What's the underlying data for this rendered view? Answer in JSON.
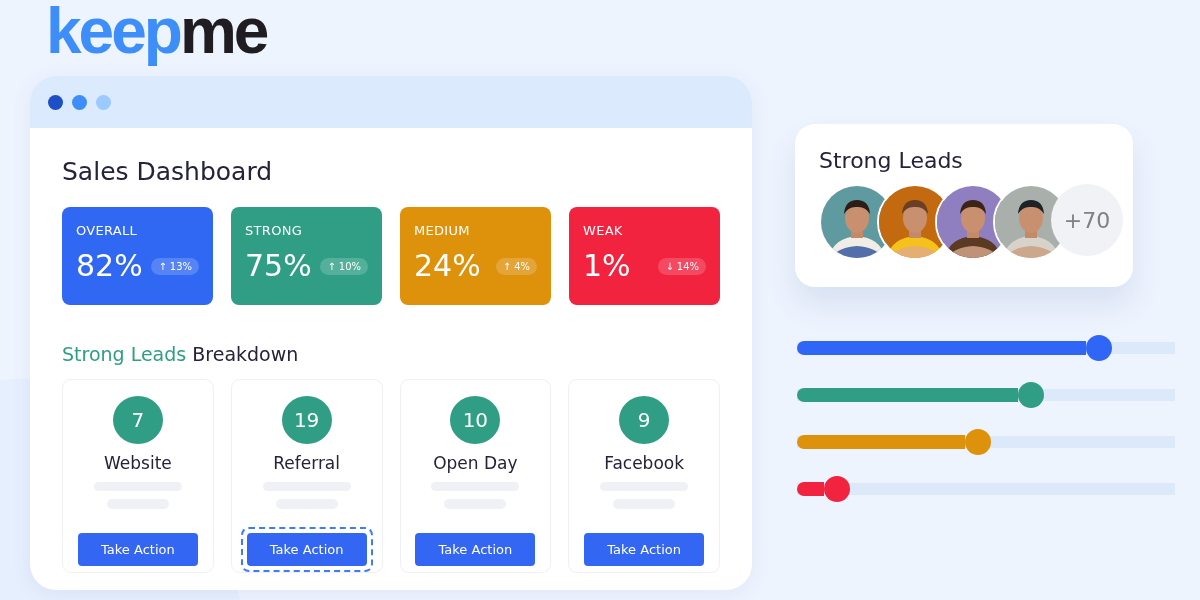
{
  "logo": {
    "brand": "keep",
    "accent": "me"
  },
  "window": {
    "title": "Sales Dashboard",
    "stats": [
      {
        "label": "OVERALL",
        "value": "82%",
        "arrow": "↑",
        "change": "13%",
        "color": "#3168f3"
      },
      {
        "label": "STRONG",
        "value": "75%",
        "arrow": "↑",
        "change": "10%",
        "color": "#2f9e85"
      },
      {
        "label": "MEDIUM",
        "value": "24%",
        "arrow": "↑",
        "change": "4%",
        "color": "#de910b"
      },
      {
        "label": "WEAK",
        "value": "1%",
        "arrow": "↓",
        "change": "14%",
        "color": "#f2233f"
      }
    ],
    "breakdown": {
      "highlight": "Strong Leads",
      "heading": "Breakdown",
      "sources": [
        {
          "count": "7",
          "name": "Website",
          "button": "Take Action",
          "focused": false
        },
        {
          "count": "19",
          "name": "Referral",
          "button": "Take Action",
          "focused": true
        },
        {
          "count": "10",
          "name": "Open Day",
          "button": "Take Action",
          "focused": false
        },
        {
          "count": "9",
          "name": "Facebook",
          "button": "Take Action",
          "focused": false
        }
      ]
    }
  },
  "leads_card": {
    "title": "Strong Leads",
    "more": "+70"
  },
  "sliders": [
    {
      "level": 0.8,
      "color": "#2f66f5"
    },
    {
      "level": 0.62,
      "color": "#2f9e85"
    },
    {
      "level": 0.48,
      "color": "#de910b"
    },
    {
      "level": 0.105,
      "color": "#f2233f"
    }
  ]
}
